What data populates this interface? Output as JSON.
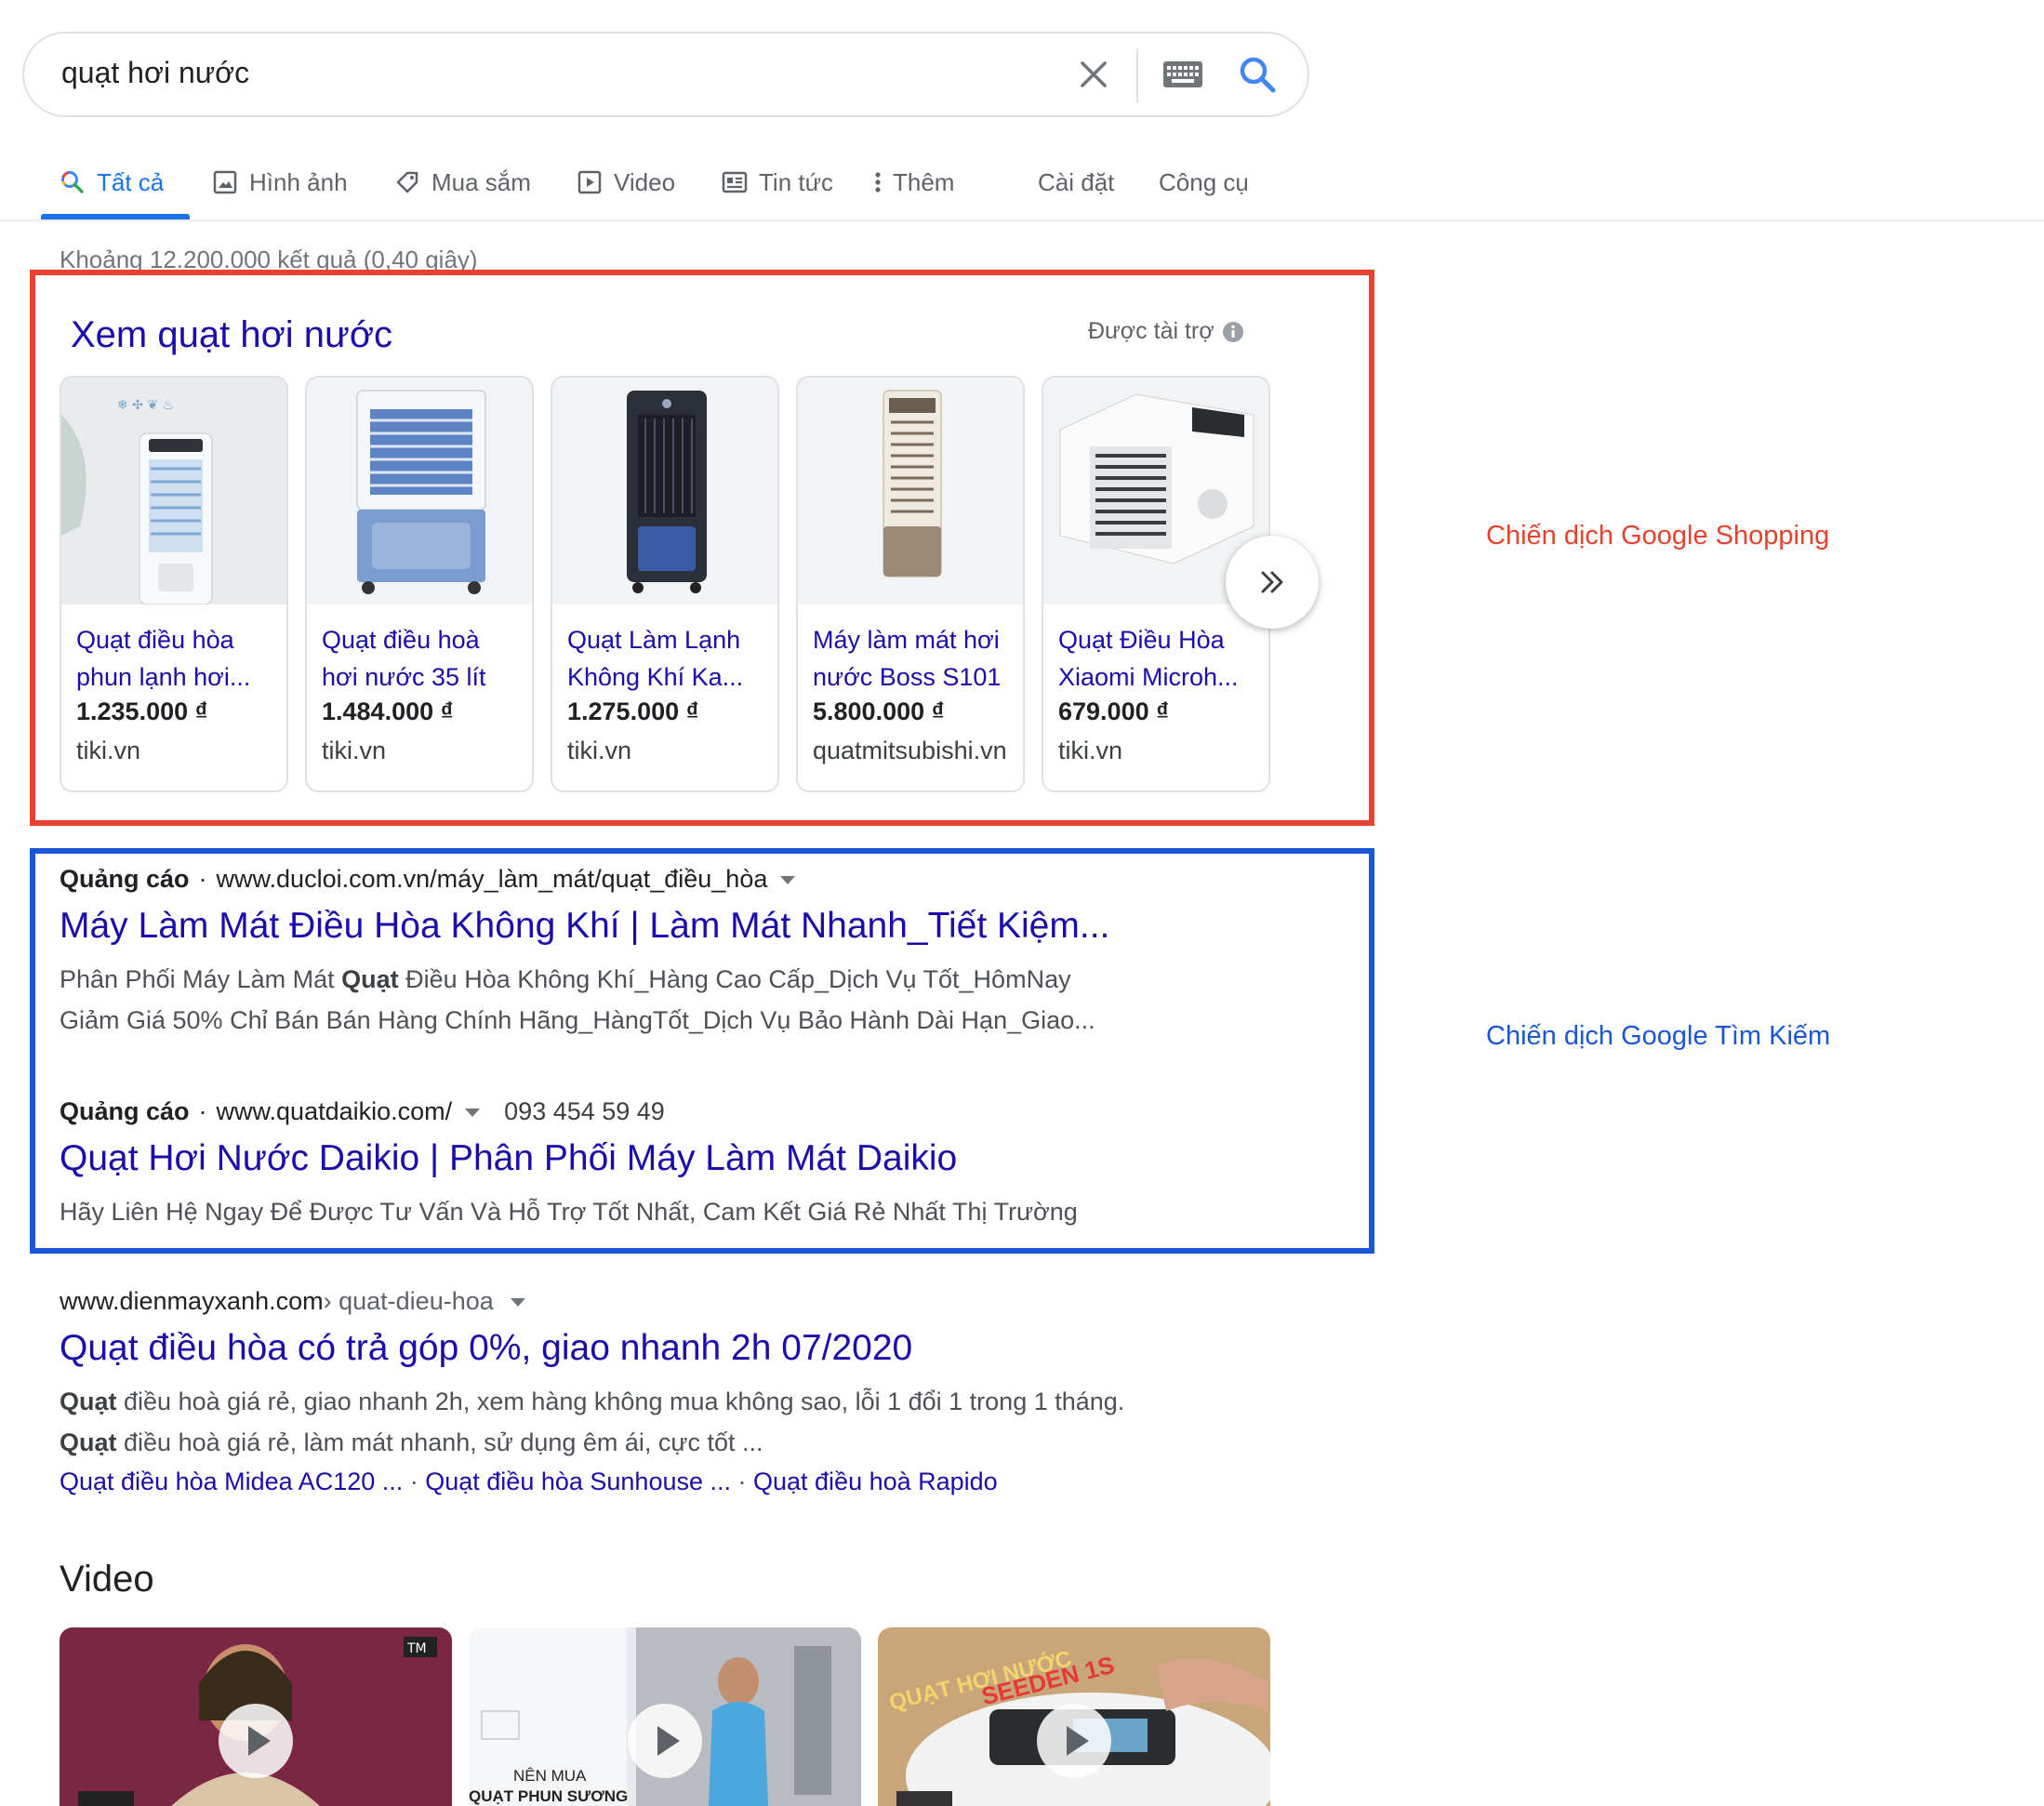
{
  "search": {
    "query": "quạt hơi nước"
  },
  "tabs": [
    {
      "label": "Tất cả",
      "icon": "search-icon"
    },
    {
      "label": "Hình ảnh",
      "icon": "image-icon"
    },
    {
      "label": "Mua sắm",
      "icon": "tag-icon"
    },
    {
      "label": "Video",
      "icon": "play-icon"
    },
    {
      "label": "Tin tức",
      "icon": "news-icon"
    },
    {
      "label": "Thêm",
      "icon": "more-vert-icon"
    },
    {
      "label": "Cài đặt"
    },
    {
      "label": "Công cụ"
    }
  ],
  "result_stats": "Khoảng 12.200.000 kết quả (0,40 giây)",
  "shopping": {
    "title": "Xem quạt hơi nước",
    "sponsored": "Được tài trợ",
    "products": [
      {
        "name1": "Quạt điều hòa",
        "name2": "phun lạnh hơi...",
        "price": "1.235.000 ₫",
        "store": "tiki.vn"
      },
      {
        "name1": "Quạt điều hoà",
        "name2": "hơi nước 35 lít",
        "price": "1.484.000 ₫",
        "store": "tiki.vn"
      },
      {
        "name1": "Quạt Làm Lạnh",
        "name2": "Không Khí Ka...",
        "price": "1.275.000 ₫",
        "store": "tiki.vn"
      },
      {
        "name1": "Máy làm mát hơi",
        "name2": "nước Boss S101",
        "price": "5.800.000 ₫",
        "store": "quatmitsubishi.vn"
      },
      {
        "name1": "Quạt Điều Hòa",
        "name2": "Xiaomi Microh...",
        "price": "679.000 ₫",
        "store": "tiki.vn"
      }
    ]
  },
  "annotations": {
    "shopping_label": "Chiến dịch Google Shopping",
    "search_label": "Chiến dịch Google Tìm Kiếm",
    "shopping_color": "#e8412d",
    "search_color": "#1a56d6"
  },
  "ads": [
    {
      "badge": "Quảng cáo",
      "url": "www.ducloi.com.vn/máy_làm_mát/quạt_điều_hòa",
      "phone": "",
      "title": "Máy Làm Mát Điều Hòa Không Khí | Làm Mát Nhanh_Tiết Kiệm...",
      "desc1_pre": "Phân Phối Máy Làm Mát ",
      "desc1_bold": "Quạt",
      "desc1_post": " Điều Hòa Không Khí_Hàng Cao Cấp_Dịch Vụ Tốt_HômNay",
      "desc2": "Giảm Giá 50% Chỉ Bán Bán Hàng Chính Hãng_HàngTốt_Dịch Vụ Bảo Hành Dài Hạn_Giao..."
    },
    {
      "badge": "Quảng cáo",
      "url": "www.quatdaikio.com/",
      "phone": "093 454 59 49",
      "title": "Quạt Hơi Nước Daikio | Phân Phối Máy Làm Mát Daikio",
      "desc1": "Hãy Liên Hệ Ngay Để Được Tư Vấn Và Hỗ Trợ Tốt Nhất, Cam Kết Giá Rẻ Nhất Thị Trường"
    }
  ],
  "organic": {
    "domain": "www.dienmayxanh.com",
    "crumb": " › quat-dieu-hoa",
    "title": "Quạt điều hòa có trả góp 0%, giao nhanh 2h 07/2020",
    "line1_bold": "Quạt",
    "line1": " điều hoà giá rẻ, giao nhanh 2h, xem hàng không mua không sao, lỗi 1 đổi 1 trong 1 tháng.",
    "line2_bold": "Quạt",
    "line2": " điều hoà giá rẻ, làm mát nhanh, sử dụng êm ái, cực tốt ...",
    "sitelinks": [
      "Quạt điều hòa Midea AC120 ...",
      "Quạt điều hòa Sunhouse ...",
      "Quạt điều hoà Rapido"
    ],
    "sitelink_sep": " · "
  },
  "video": {
    "heading": "Video",
    "thumb2_caption1": "NÊN MUA",
    "thumb2_caption2": "QUẠT PHUN SƯƠNG",
    "thumb3_caption1": "QUẠT HƠI NƯỚC",
    "thumb3_caption2": "SEEDEN 1S"
  }
}
